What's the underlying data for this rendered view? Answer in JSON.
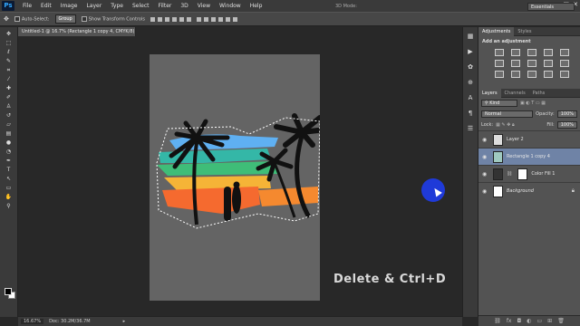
{
  "app": {
    "logo": "Ps"
  },
  "menu": [
    "File",
    "Edit",
    "Image",
    "Layer",
    "Type",
    "Select",
    "Filter",
    "3D",
    "View",
    "Window",
    "Help"
  ],
  "window_controls": [
    "–",
    "□",
    "✕"
  ],
  "options_bar": {
    "auto_select_label": "Auto-Select:",
    "auto_select_value": "Group",
    "show_transform_label": "Show Transform Controls",
    "mode_3d": "3D Mode:",
    "workspace": "Essentials"
  },
  "document": {
    "tab_title": "Untitled-1 @ 16.7% (Rectangle 1 copy 4, CMYK/8) * ×",
    "zoom": "16.67%",
    "doc_size": "Doc: 30.2M/36.7M"
  },
  "caption": "Delete & Ctrl+D",
  "adjustments": {
    "tabs": [
      "Adjustments",
      "Styles"
    ],
    "title": "Add an adjustment"
  },
  "layers_panel": {
    "tabs": [
      "Layers",
      "Channels",
      "Paths"
    ],
    "filter_value": "Kind",
    "blend_mode": "Normal",
    "opacity_label": "Opacity:",
    "opacity_value": "100%",
    "lock_label": "Lock:",
    "fill_label": "Fill:",
    "fill_value": "100%",
    "layers": [
      {
        "name": "Layer 2"
      },
      {
        "name": "Rectangle 1 copy 4"
      },
      {
        "name": "Color Fill 1"
      },
      {
        "name": "Background"
      }
    ],
    "footer_icons": [
      "link-icon",
      "fx-icon",
      "mask-icon",
      "adjustment-icon",
      "group-icon",
      "new-layer-icon",
      "trash-icon"
    ]
  },
  "colors": {
    "stroke_blue": "#5fb0f2",
    "stroke_teal": "#34b7a7",
    "stroke_green": "#3fbd78",
    "stroke_yellow": "#f5b437",
    "stroke_orange": "#f56a2f",
    "canvas": "#646464",
    "cursor": "#1f3ad8",
    "selected_layer": "#6f83a6"
  }
}
